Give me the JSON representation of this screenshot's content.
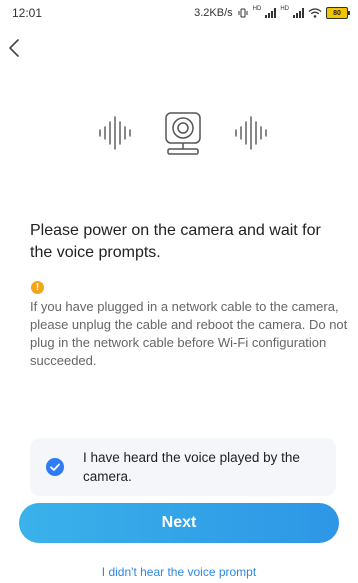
{
  "status_bar": {
    "time": "12:01",
    "speed": "3.2KB/s",
    "network_labels": [
      "HD",
      "HD"
    ],
    "battery": "80",
    "icons": [
      "vibrate-icon",
      "signal-icon",
      "signal-icon",
      "wifi-icon",
      "battery-icon"
    ]
  },
  "nav": {
    "back_icon": "chevron-left-icon"
  },
  "illustration": {
    "icon": "camera-voice-icon"
  },
  "content": {
    "instruction": "Please power on the camera and wait for the voice prompts.",
    "warning_icon": "!",
    "warning_text": "If you have plugged in a network cable to the camera, please unplug the cable and reboot the camera. Do not plug in the network cable before Wi-Fi configuration succeeded."
  },
  "confirmation": {
    "label": "I have heard the voice played by the camera.",
    "checked": true
  },
  "actions": {
    "next_label": "Next",
    "no_voice_link": "I didn't hear the voice prompt"
  },
  "colors": {
    "accent": "#2f7bf5",
    "button_start": "#3ab2ea",
    "button_end": "#2d96e6",
    "warning": "#f2a51a",
    "link": "#2d88e0"
  }
}
